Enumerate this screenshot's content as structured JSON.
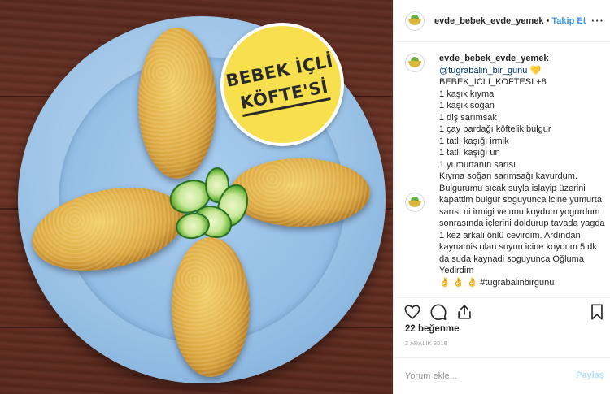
{
  "photo": {
    "badge_line1": "BEBEK İÇLİ",
    "badge_line2": "KÖFTE'Sİ",
    "badge_color": "#f7df4d",
    "plate_color": "#9cc3e6",
    "table_color": "#5b2a1f"
  },
  "header": {
    "username": "evde_bebek_evde_yemek",
    "separator": "•",
    "follow_label": "Takip Et",
    "more_label": "···",
    "follow_color": "#3897f0"
  },
  "caption": {
    "username": "evde_bebek_evde_yemek",
    "mention": "@tugrabalin_bir_gunu",
    "heart": "💛",
    "lines": [
      "BEBEK_ICLI_KOFTESI +8",
      "1 kaşık kıyma",
      "1 kaşık soğan",
      "1 diş sarımsak",
      "1 çay bardağı köftelik bulgur",
      "1 tatlı kaşığı irmik",
      "1 tatlı kaşığı un",
      "1 yumurtanın sarısı"
    ],
    "paragraph": "Kıyma soğan sarımsağı kavurdum. Bulgurumu sıcak suyla islayip üzerini kapattim bulgur soguyunca icine yumurta sarısı ni irmigi ve unu koydum yogurdum sonrasında içlerini doldurup tavada yagda 1 kez arkali önlü cevirdim. Ardından kaynamis olan suyun icine koydum 5 dk da suda kaynadi soguyunca Oğluma Yedirdim",
    "cut_line": "👌 👌 👌 #tugrabalinbirgunu"
  },
  "actions": {
    "like_icon": "heart-outline-icon",
    "comment_icon": "comment-bubble-icon",
    "share_icon": "share-arrow-icon",
    "save_icon": "bookmark-icon"
  },
  "likes_text": "22 beğenme",
  "date_text": "2 ARALIK 2018",
  "comment": {
    "placeholder": "Yorum ekle...",
    "post_label": "Paylaş"
  }
}
